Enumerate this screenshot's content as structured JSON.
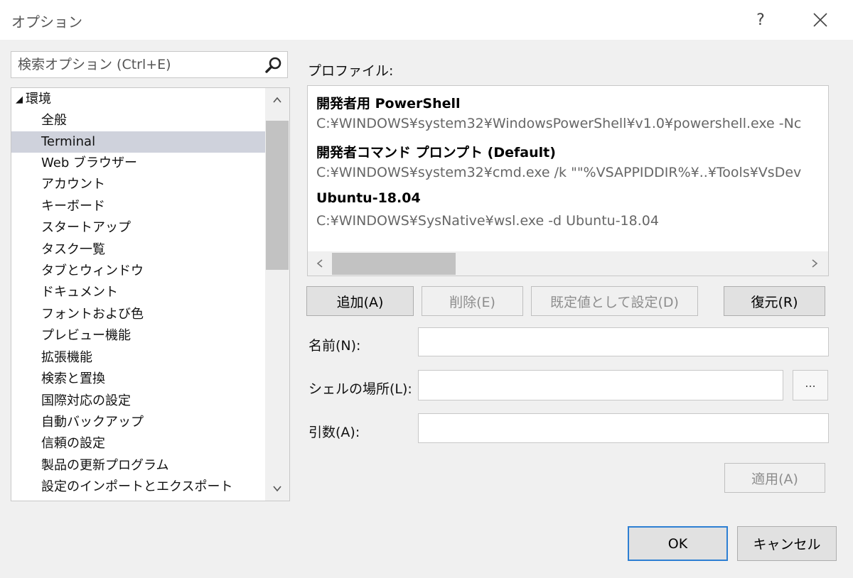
{
  "window": {
    "title": "オプション",
    "help_label": "?"
  },
  "search": {
    "placeholder": "検索オプション (Ctrl+E)"
  },
  "tree": {
    "root": "環境",
    "items": [
      {
        "label": "全般"
      },
      {
        "label": "Terminal",
        "selected": true
      },
      {
        "label": "Web ブラウザー"
      },
      {
        "label": "アカウント"
      },
      {
        "label": "キーボード"
      },
      {
        "label": "スタートアップ"
      },
      {
        "label": "タスク一覧"
      },
      {
        "label": "タブとウィンドウ"
      },
      {
        "label": "ドキュメント"
      },
      {
        "label": "フォントおよび色"
      },
      {
        "label": "プレビュー機能"
      },
      {
        "label": "拡張機能"
      },
      {
        "label": "検索と置換"
      },
      {
        "label": "国際対応の設定"
      },
      {
        "label": "自動バックアップ"
      },
      {
        "label": "信頼の設定"
      },
      {
        "label": "製品の更新プログラム"
      },
      {
        "label": "設定のインポートとエクスポート"
      }
    ]
  },
  "profiles": {
    "label": "プロファイル:",
    "items": [
      {
        "name": "開発者用 PowerShell",
        "path": "C:¥WINDOWS¥system32¥WindowsPowerShell¥v1.0¥powershell.exe -Nc"
      },
      {
        "name": "開発者コマンド プロンプト (Default)",
        "path": "C:¥WINDOWS¥system32¥cmd.exe /k \"\"%VSAPPIDDIR%¥..¥Tools¥VsDev"
      },
      {
        "name": "Ubuntu-18.04",
        "path": "C:¥WINDOWS¥SysNative¥wsl.exe -d Ubuntu-18.04"
      }
    ]
  },
  "buttons": {
    "add": "追加(A)",
    "delete": "削除(E)",
    "set_default": "既定値として設定(D)",
    "restore": "復元(R)",
    "apply": "適用(A)",
    "browse": "...",
    "ok": "OK",
    "cancel": "キャンセル"
  },
  "fields": {
    "name_label": "名前(N):",
    "name_value": "",
    "shell_label": "シェルの場所(L):",
    "shell_value": "",
    "args_label": "引数(A):",
    "args_value": ""
  }
}
